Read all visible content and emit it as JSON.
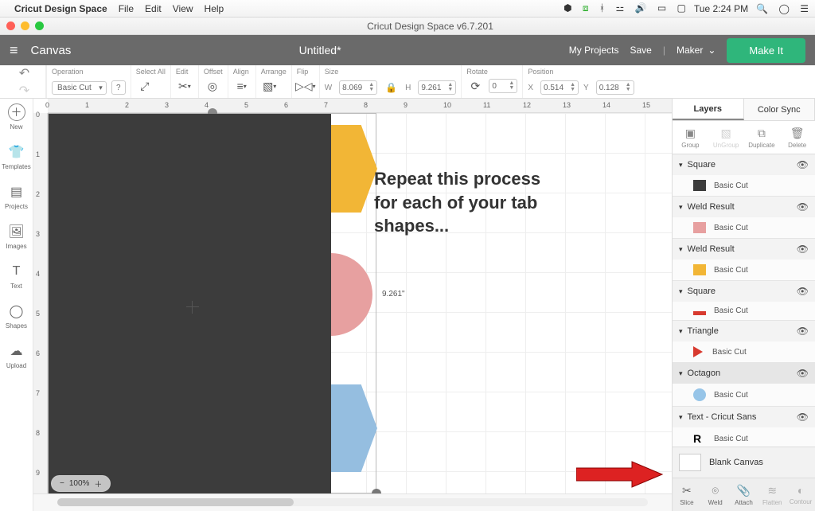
{
  "mac_menu": {
    "app_name": "Cricut Design Space",
    "items": [
      "File",
      "Edit",
      "View",
      "Help"
    ],
    "clock": "Tue 2:24 PM"
  },
  "window_title": "Cricut Design Space  v6.7.201",
  "app_topbar": {
    "canvas": "Canvas",
    "doc_title": "Untitled*",
    "my_projects": "My Projects",
    "save": "Save",
    "machine": "Maker",
    "make_it": "Make It"
  },
  "op_toolbar": {
    "operation_lbl": "Operation",
    "operation_value": "Basic Cut",
    "select_all": "Select All",
    "edit": "Edit",
    "offset": "Offset",
    "align": "Align",
    "arrange": "Arrange",
    "flip": "Flip",
    "size": "Size",
    "rotate": "Rotate",
    "position": "Position",
    "W": "8.069",
    "H": "9.261",
    "R": "0",
    "X": "0.514",
    "Y": "0.128"
  },
  "left_sidebar": [
    "New",
    "Templates",
    "Projects",
    "Images",
    "Text",
    "Shapes",
    "Upload"
  ],
  "canvas": {
    "dim_label": "9.261\"",
    "zoom": "100%",
    "tutorial_l1": "Repeat this process",
    "tutorial_l2": "for each of your tab",
    "tutorial_l3": "shapes...",
    "ruler_h": [
      0,
      1,
      2,
      3,
      4,
      5,
      6,
      7,
      8,
      9,
      10,
      11,
      12,
      13,
      14,
      15
    ],
    "ruler_v": [
      0,
      1,
      2,
      3,
      4,
      5,
      6,
      7,
      8,
      9
    ]
  },
  "right_panel": {
    "tabs": {
      "layers": "Layers",
      "color_sync": "Color Sync"
    },
    "actions": {
      "group": "Group",
      "ungroup": "UnGroup",
      "duplicate": "Duplicate",
      "delete": "Delete"
    },
    "layers": [
      {
        "name": "Square",
        "op": "Basic Cut",
        "color": "#3c3c3c",
        "shape": "rect",
        "selected": false
      },
      {
        "name": "Weld Result",
        "op": "Basic Cut",
        "color": "#e7a0a0",
        "shape": "rect",
        "selected": false
      },
      {
        "name": "Weld Result",
        "op": "Basic Cut",
        "color": "#f2b636",
        "shape": "rect",
        "selected": false
      },
      {
        "name": "Square",
        "op": "Basic Cut",
        "color": "#d83a2f",
        "shape": "bar",
        "selected": false
      },
      {
        "name": "Triangle",
        "op": "Basic Cut",
        "color": "#d83a2f",
        "shape": "triangle",
        "selected": false
      },
      {
        "name": "Octagon",
        "op": "Basic Cut",
        "color": "#97c5e8",
        "shape": "circle",
        "selected": true
      },
      {
        "name": "Text - Cricut Sans",
        "op": "Basic Cut",
        "color": "#000",
        "shape": "text",
        "selected": false
      }
    ],
    "blank_canvas": "Blank Canvas",
    "bottom": {
      "slice": "Slice",
      "weld": "Weld",
      "attach": "Attach",
      "flatten": "Flatten",
      "contour": "Contour"
    }
  }
}
